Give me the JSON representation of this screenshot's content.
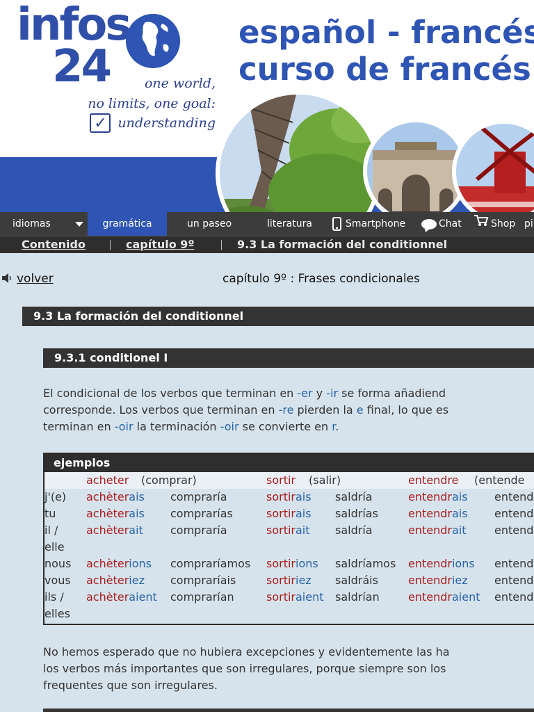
{
  "header": {
    "logo_line1": "infos",
    "logo_line2": "24",
    "tagline_1": "one world,",
    "tagline_2": "no limits, one goal:",
    "tagline_3": "understanding",
    "title_line1": "español - francés",
    "title_line2": "curso de francés"
  },
  "nav": {
    "items": [
      "idiomas",
      "gramática",
      "un paseo",
      "literatura",
      "Smartphone",
      "Chat",
      "Shop",
      "pi"
    ],
    "active": "gramática"
  },
  "breadcrumb": {
    "home": "Contenido",
    "chapter": "capítulo 9º",
    "current": "9.3 La formación del conditionnel"
  },
  "content": {
    "back_label": "volver",
    "chapter_title": "capítulo 9º : Frases condicionales",
    "section_title": "9.3 La formación del conditionnel",
    "subsection_title": "9.3.1 conditionel I",
    "para1": {
      "l1a": "El condicional de los verbos que terminan en ",
      "l1b": "-er",
      "l1c": " y ",
      "l1d": "-ir",
      "l1e": " se forma añadiend",
      "l2a": "corresponde. Los verbos que terminan en ",
      "l2b": "-re",
      "l2c": " pierden la ",
      "l2d": "e",
      "l2e": " final, lo que es",
      "l3a": "terminan en ",
      "l3b": "-oir",
      "l3c": " la terminación ",
      "l3d": "-oir",
      "l3e": " se convierte en ",
      "l3f": "r",
      "l3g": "."
    },
    "ejemplos": {
      "title": "ejemplos",
      "header": {
        "v1": "acheter",
        "v1t": "(comprar)",
        "v2": "sortir",
        "v2t": "(salir)",
        "v3": "entendre",
        "v3t": "(entende"
      },
      "rows": [
        {
          "p": "j'(e)",
          "s1": "achèter",
          "e1": "ais",
          "t1": "compraría",
          "s2": "sortir",
          "e2": "ais",
          "t2": "saldría",
          "s3": "entendr",
          "e3": "ais",
          "t3": "entend"
        },
        {
          "p": "tu",
          "s1": "achèter",
          "e1": "ais",
          "t1": "comprarías",
          "s2": "sortir",
          "e2": "ais",
          "t2": "saldrías",
          "s3": "entendr",
          "e3": "ais",
          "t3": "entend"
        },
        {
          "p": "il /",
          "s1": "achèter",
          "e1": "ait",
          "t1": "compraría",
          "s2": "sortir",
          "e2": "ait",
          "t2": "saldría",
          "s3": "entendr",
          "e3": "ait",
          "t3": "entend"
        },
        {
          "p": "elle",
          "s1": "",
          "e1": "",
          "t1": "",
          "s2": "",
          "e2": "",
          "t2": "",
          "s3": "",
          "e3": "",
          "t3": ""
        },
        {
          "p": "nous",
          "s1": "achèter",
          "e1": "ions",
          "t1": "compraríamos",
          "s2": "sortir",
          "e2": "ions",
          "t2": "saldríamos",
          "s3": "entendr",
          "e3": "ions",
          "t3": "entend"
        },
        {
          "p": "vous",
          "s1": "achèter",
          "e1": "iez",
          "t1": "compraríais",
          "s2": "sortir",
          "e2": "iez",
          "t2": "saldráis",
          "s3": "entendr",
          "e3": "iez",
          "t3": "entend"
        },
        {
          "p": "ils /",
          "s1": "achèter",
          "e1": "aient",
          "t1": "comprarían",
          "s2": "sortir",
          "e2": "aient",
          "t2": "saldrían",
          "s3": "entendr",
          "e3": "aient",
          "t3": "entend"
        },
        {
          "p": "elles",
          "s1": "",
          "e1": "",
          "t1": "",
          "s2": "",
          "e2": "",
          "t2": "",
          "s3": "",
          "e3": "",
          "t3": ""
        }
      ]
    },
    "para2": {
      "l1": "No hemos esperado que no hubiera excepciones y evidentemente las ha",
      "l2": "los verbos más importantes que son irregulares, porque siempre son los",
      "l3": "frequentes que son irregulares."
    }
  },
  "colors": {
    "brand_blue": "#2f55b4",
    "nav_bg": "#3c3c3c",
    "verb_red": "#a81d1d",
    "ending_blue": "#2563a8",
    "page_bg": "#d7e3ec"
  },
  "icons": [
    "globe-icon",
    "checkbox-icon",
    "caret-down-icon",
    "smartphone-icon",
    "chat-bubble-icon",
    "cart-icon",
    "speaker-icon"
  ]
}
